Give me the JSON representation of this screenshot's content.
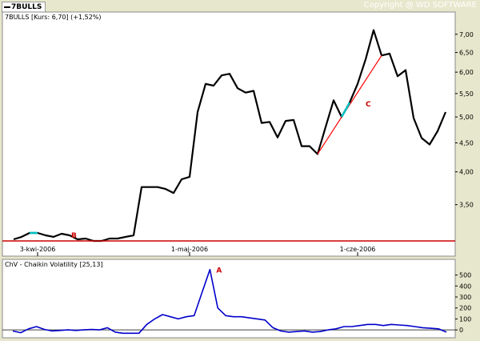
{
  "tab_label": "7BULLS",
  "copyright": "Copyright @ WD SOFTWARE",
  "chart_data": [
    {
      "type": "line",
      "title": "7BULLS [Kurs: 6,70] (+1,52%)",
      "x_tick_labels": [
        "3-kwi-2006",
        "1-maj-2006",
        "1-cze-2006"
      ],
      "y_tick_labels": [
        "3,50",
        "4,00",
        "4,50",
        "5,00",
        "5,50",
        "6,00",
        "6,50",
        "7,00"
      ],
      "ylim": [
        3.13,
        7.25
      ],
      "scale": "log",
      "series": [
        {
          "color": "#000000",
          "values": [
            3.04,
            3.07,
            3.12,
            3.12,
            3.09,
            3.07,
            3.11,
            3.09,
            3.04,
            3.05,
            3.02,
            3.02,
            3.05,
            3.05,
            3.07,
            3.09,
            3.76,
            3.76,
            3.76,
            3.73,
            3.67,
            3.88,
            3.92,
            5.1,
            5.72,
            5.68,
            5.92,
            5.96,
            5.62,
            5.52,
            5.56,
            4.88,
            4.9,
            4.6,
            4.92,
            4.94,
            4.44,
            4.44,
            4.3,
            4.8,
            5.35,
            5.0,
            5.3,
            5.72,
            6.32,
            7.12,
            6.42,
            6.47,
            5.9,
            6.05,
            4.98,
            4.59,
            4.47,
            4.72,
            5.1
          ]
        }
      ],
      "annotations": [
        {
          "label": "B",
          "type": "horizontal-line",
          "y": 3.13,
          "color": "#cc0000"
        },
        {
          "label": "C",
          "type": "trendline",
          "from_index": 38,
          "to_index": 46,
          "color": "#ff0000"
        },
        {
          "label": "",
          "type": "highlight",
          "from_index": 2,
          "to_index": 3,
          "color": "#00c0c0"
        },
        {
          "label": "",
          "type": "highlight",
          "from_index": 41,
          "to_index": 42,
          "color": "#00c0c0"
        }
      ]
    },
    {
      "type": "line",
      "title": "ChV - Chaikin Volatility [25,13]",
      "y_tick_labels": [
        "0",
        "100",
        "200",
        "300",
        "400",
        "500"
      ],
      "ylim": [
        -50,
        570
      ],
      "series": [
        {
          "color": "#0000cc",
          "values": [
            -10,
            -25,
            10,
            30,
            5,
            -10,
            -5,
            0,
            -5,
            0,
            5,
            0,
            20,
            -20,
            -30,
            -30,
            -30,
            50,
            100,
            140,
            120,
            100,
            120,
            130,
            340,
            550,
            200,
            130,
            120,
            120,
            110,
            100,
            90,
            20,
            -10,
            -20,
            -15,
            -10,
            -20,
            -15,
            0,
            10,
            30,
            30,
            40,
            50,
            50,
            40,
            50,
            45,
            40,
            30,
            20,
            15,
            10,
            -20
          ]
        }
      ],
      "annotations": [
        {
          "label": "A",
          "type": "peak-marker",
          "index": 25,
          "color": "#cc0000"
        }
      ]
    }
  ]
}
